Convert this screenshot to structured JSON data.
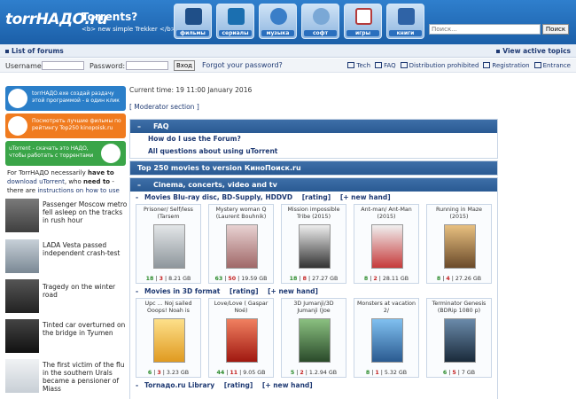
{
  "header": {
    "logo": "torrНАДО.ru",
    "title": "Torrents?",
    "subtitle": "<b> new simple Trekker </b>",
    "categories": [
      {
        "label": "фильмы",
        "icon": "film-icon",
        "color": "#1f4f88"
      },
      {
        "label": "сериалы",
        "icon": "tv-icon",
        "color": "#1b6fb0"
      },
      {
        "label": "музыка",
        "icon": "music-icon",
        "color": "#3a7ec8"
      },
      {
        "label": "софт",
        "icon": "disc-icon",
        "color": "#7aa8d6"
      },
      {
        "label": "игры",
        "icon": "cards-icon",
        "color": "#b43c3c"
      },
      {
        "label": "книги",
        "icon": "book-icon",
        "color": "#2f63a6"
      }
    ],
    "search_placeholder": "Поиск...",
    "search_button": "Поиск"
  },
  "nav": {
    "list_forums": "List of forums",
    "view_active": "View active topics"
  },
  "login": {
    "username_label": "Username:",
    "password_label": "Password:",
    "login_button": "Вход",
    "forgot": "Forgot your password?",
    "links": [
      "Tech",
      "FAQ",
      "Distribution prohibited",
      "Registration",
      "Entrance"
    ]
  },
  "left": {
    "banners": [
      {
        "text": "torrНАДО.exe создай раздачу этой программой - в один клик",
        "color": "#2b7fc9"
      },
      {
        "text": "Посмотреть лучшие фильмы по рейтингу Top250 kinopoisk.ru",
        "color": "#f07b1f"
      },
      {
        "text": "uTorrent - скачать это НАДО, чтобы работать с торрентами",
        "color": "#3aa548"
      }
    ],
    "info_1": "For TorrНАДО necessarily",
    "info_2": "have to",
    "info_3": "download",
    "info_4": "uTorrent",
    "info_5": ", who",
    "info_6": "need to",
    "info_7": "-there are",
    "info_8": "instructions on how to use",
    "news": [
      {
        "text": "Passenger Moscow metro fell asleep on the tracks in rush hour",
        "color": "#5a5a5a"
      },
      {
        "text": "LADA Vesta passed independent crash-test",
        "color": "#8a9aa8"
      },
      {
        "text": "Tragedy on the winter road",
        "color": "#3a3a3a"
      },
      {
        "text": "Tinted car overturned on the bridge in Tyumen",
        "color": "#2c2c2c"
      },
      {
        "text": "The first victim of the flu in the southern Urals became a pensioner of Miass",
        "color": "#d8dde2"
      }
    ]
  },
  "main": {
    "time": "Current time: 19 11:00 January 2016",
    "moderator": "[ Moderator section ]",
    "faq_title": "FAQ",
    "faq_items": [
      "How do I use the Forum?",
      "All questions about using uTorrent"
    ],
    "top250": "Top 250 movies to version КиноПоиск.ru",
    "cinema_title": "Cinema, concerts, video and tv",
    "sub1": {
      "minus": "-",
      "name": "Movies Blu-ray disc, BD-Supply, HDDVD",
      "rating": "[rating]",
      "new": "[+ new hand]"
    },
    "sub2": {
      "minus": "-",
      "name": "Movies in 3D format",
      "rating": "[rating]",
      "new": "[+ new hand]"
    },
    "sub3": {
      "minus": "-",
      "name": "Tornадо.ru Library",
      "rating": "[rating]",
      "new": "[+ new hand]"
    },
    "row1": [
      {
        "title": "Prisoner/ Self/less (Tarsem",
        "seed": "18",
        "leech": "3",
        "size": "8.21 GB",
        "color": "#cfd3d6"
      },
      {
        "title": "Mystery woman Q (Laurent Bouhnik)",
        "seed": "63",
        "leech": "50",
        "size": "19.59 GB",
        "color": "#c8a8a8"
      },
      {
        "title": "Mission impossible Tribe (2015)",
        "seed": "18",
        "leech": "8",
        "size": "27.27 GB",
        "color": "#4a4a4a"
      },
      {
        "title": "Ant-man/ Ant-Man (2015)",
        "seed": "8",
        "leech": "2",
        "size": "28.11 GB",
        "color": "#c63a3a"
      },
      {
        "title": "Running in Maze (2015)",
        "seed": "8",
        "leech": "4",
        "size": "27.26 GB",
        "color": "#c8893a"
      }
    ],
    "row2": [
      {
        "title": "Upc ... Noj sailed Ooops! Noah is",
        "seed": "6",
        "leech": "3",
        "size": "3.23 GB",
        "color": "#e8b040"
      },
      {
        "title": "Love/Love ( Gaspar Noé)",
        "seed": "44",
        "leech": "11",
        "size": "9.05 GB",
        "color": "#c83020"
      },
      {
        "title": "3D Jumanji/3D Jumanji (Joe",
        "seed": "5",
        "leech": "2",
        "size": "1.2.94 GB",
        "color": "#3a7a3a"
      },
      {
        "title": "Monsters at vacation 2/",
        "seed": "8",
        "leech": "1",
        "size": "5.32 GB",
        "color": "#3a80c0"
      },
      {
        "title": "Terminator Genesis (BDRip 1080 p)",
        "seed": "6",
        "leech": "5",
        "size": "7 GB",
        "color": "#2a4a6a"
      }
    ]
  }
}
